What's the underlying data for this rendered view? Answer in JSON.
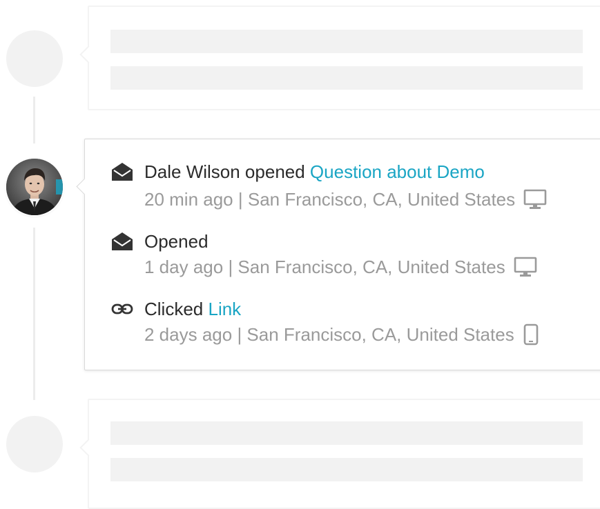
{
  "feed": {
    "activity": {
      "avatar_alt": "Dale Wilson",
      "events": [
        {
          "icon": "envelope-open-icon",
          "prefix": "Dale Wilson opened ",
          "link": "Question about Demo",
          "time": "20 min ago",
          "separator": " | ",
          "location": "San Francisco, CA, United States",
          "device": "desktop-icon"
        },
        {
          "icon": "envelope-open-icon",
          "prefix": "Opened",
          "link": "",
          "time": "1 day ago",
          "separator": " | ",
          "location": "San Francisco, CA, United States",
          "device": "desktop-icon"
        },
        {
          "icon": "link-icon",
          "prefix": "Clicked ",
          "link": "Link",
          "time": "2 days ago",
          "separator": " | ",
          "location": "San Francisco, CA, United States",
          "device": "mobile-icon"
        }
      ]
    }
  },
  "colors": {
    "link": "#1aa5c4",
    "text": "#2b2b2b",
    "meta": "#9a9a9a",
    "skeleton": "#f2f2f2"
  }
}
